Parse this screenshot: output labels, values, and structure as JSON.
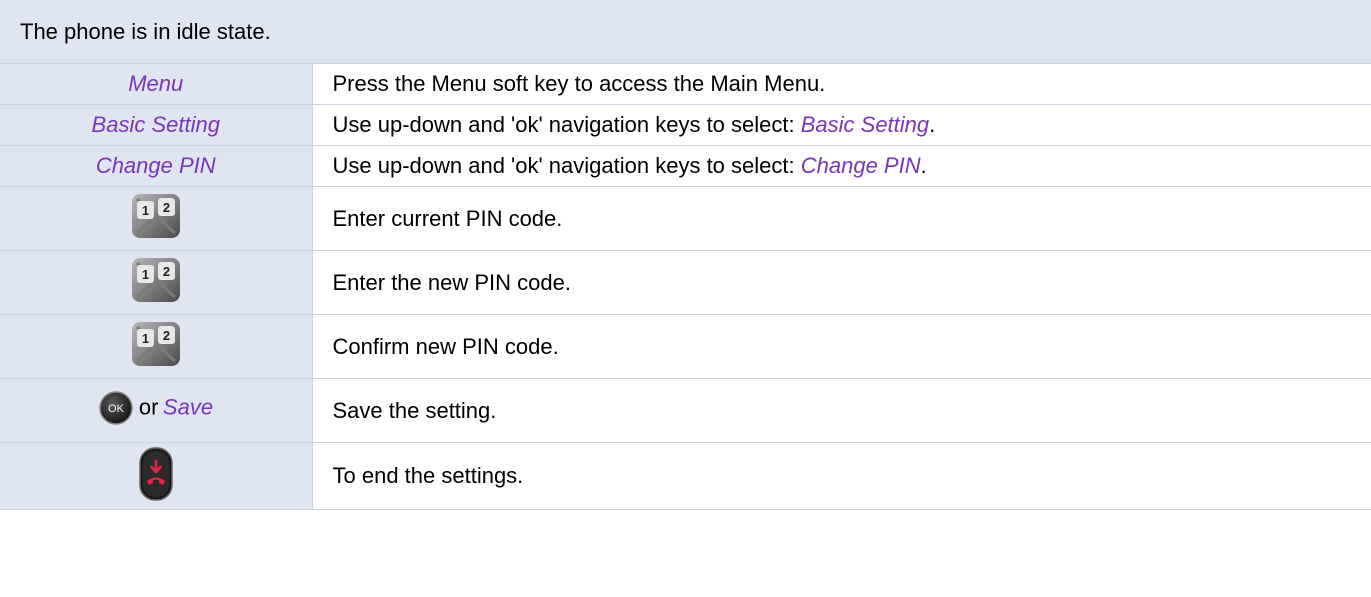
{
  "header": {
    "text": "The phone is in idle state."
  },
  "rows": [
    {
      "key": "Menu",
      "desc": "Press the Menu soft key to access the Main Menu."
    },
    {
      "key": "Basic Setting",
      "desc_prefix": "Use up-down and 'ok' navigation keys to select: ",
      "desc_em": "Basic Setting",
      "desc_suffix": "."
    },
    {
      "key": "Change PIN",
      "desc_prefix": "Use up-down and 'ok' navigation keys to select: ",
      "desc_em": "Change PIN",
      "desc_suffix": "."
    },
    {
      "icon": "numeric-keypad-icon",
      "desc": "Enter current PIN code."
    },
    {
      "icon": "numeric-keypad-icon",
      "desc": "Enter the new PIN code."
    },
    {
      "icon": "numeric-keypad-icon",
      "desc": "Confirm new PIN code."
    },
    {
      "icon": "ok-button-icon",
      "icon_label": "OK",
      "key_or": "or",
      "key_em": "Save",
      "desc": "Save the setting."
    },
    {
      "icon": "hang-up-key-icon",
      "desc": "To end the settings."
    }
  ],
  "colors": {
    "header_bg": "#dfe6f1",
    "key_text": "#7a35b8",
    "hangup_red": "#e8244e"
  }
}
